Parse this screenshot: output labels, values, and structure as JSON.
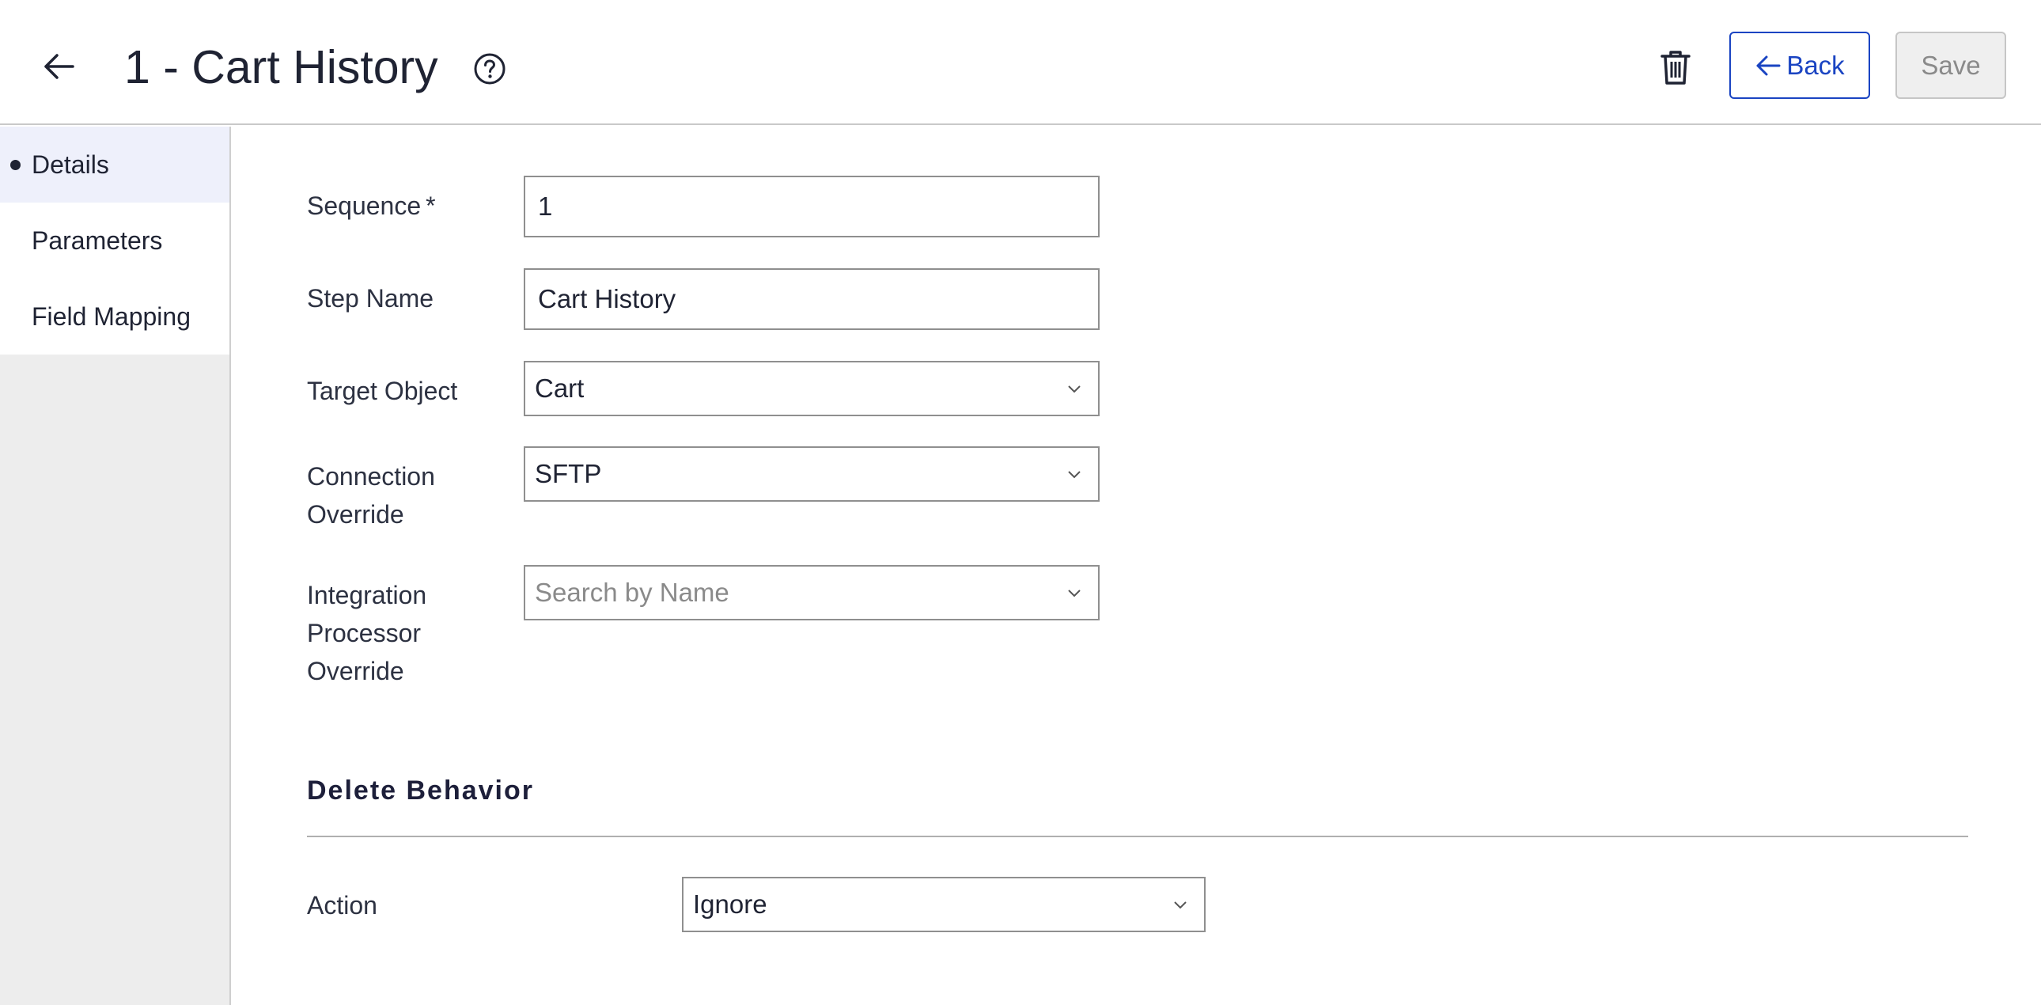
{
  "header": {
    "title": "1 - Cart History",
    "back_label": "Back",
    "save_label": "Save"
  },
  "sidebar": {
    "items": [
      {
        "label": "Details",
        "active": true
      },
      {
        "label": "Parameters",
        "active": false
      },
      {
        "label": "Field Mapping",
        "active": false
      }
    ]
  },
  "form": {
    "sequence": {
      "label": "Sequence",
      "required_mark": "*",
      "value": "1"
    },
    "step_name": {
      "label": "Step Name",
      "value": "Cart History"
    },
    "target_object": {
      "label": "Target Object",
      "value": "Cart"
    },
    "connection_override": {
      "label_line1": "Connection",
      "label_line2": "Override",
      "value": "SFTP"
    },
    "integration_processor_override": {
      "label_line1": "Integration",
      "label_line2": "Processor",
      "label_line3": "Override",
      "placeholder": "Search by Name"
    }
  },
  "delete_behavior": {
    "title": "Delete Behavior",
    "action": {
      "label": "Action",
      "value": "Ignore"
    }
  },
  "icons": {
    "back": "arrow-left-icon",
    "help": "help-circle-icon",
    "delete": "trash-icon",
    "dropdown": "chevron-down-icon"
  },
  "colors": {
    "accent": "#1a44c2",
    "active_nav_bg": "#eef0fb",
    "sidebar_bg": "#ededed"
  }
}
